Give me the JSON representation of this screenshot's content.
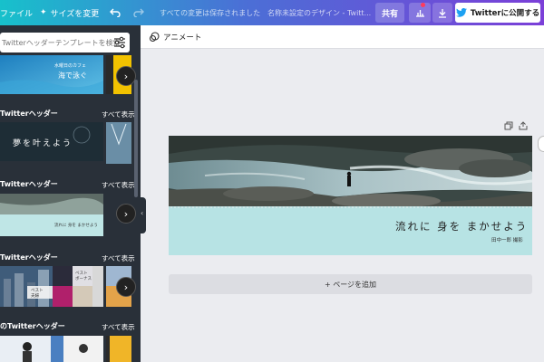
{
  "topbar": {
    "file_label": "ファイル",
    "resize_label": "サイズを変更",
    "saved_status": "すべての変更は保存されました",
    "doc_title": "名称未設定のデザイン - Twitt...",
    "share_label": "共有",
    "publish_label": "Twitterに公開する",
    "colors": {
      "start": "#17c1cb",
      "end": "#7b3fd8"
    }
  },
  "sidebar": {
    "search_placeholder": "Twitterヘッダーテンプレートを検索",
    "sections": [
      {
        "title": "Twitterヘッダー",
        "see_all": "すべて表示"
      },
      {
        "title": "Twitterヘッダー",
        "see_all": "すべて表示"
      },
      {
        "title": "Twitterヘッダー",
        "see_all": "すべて表示"
      },
      {
        "title": "のTwitterヘッダー",
        "see_all": "すべて表示"
      }
    ],
    "thumb_texts": {
      "t0_line1": "水曜日のカフェ",
      "t0_line2": "海で泳ぐ",
      "t1_text": "夢を叶えよう",
      "t3_a": "ベスト\n夫婦",
      "t3_b": "ベスト\nボーナス"
    }
  },
  "toolbar": {
    "animate_label": "アニメート"
  },
  "canvas": {
    "caption": "流れに 身を まかせよう",
    "credit": "田中一郎 撮影",
    "add_page_label": "+ ページを追加"
  }
}
